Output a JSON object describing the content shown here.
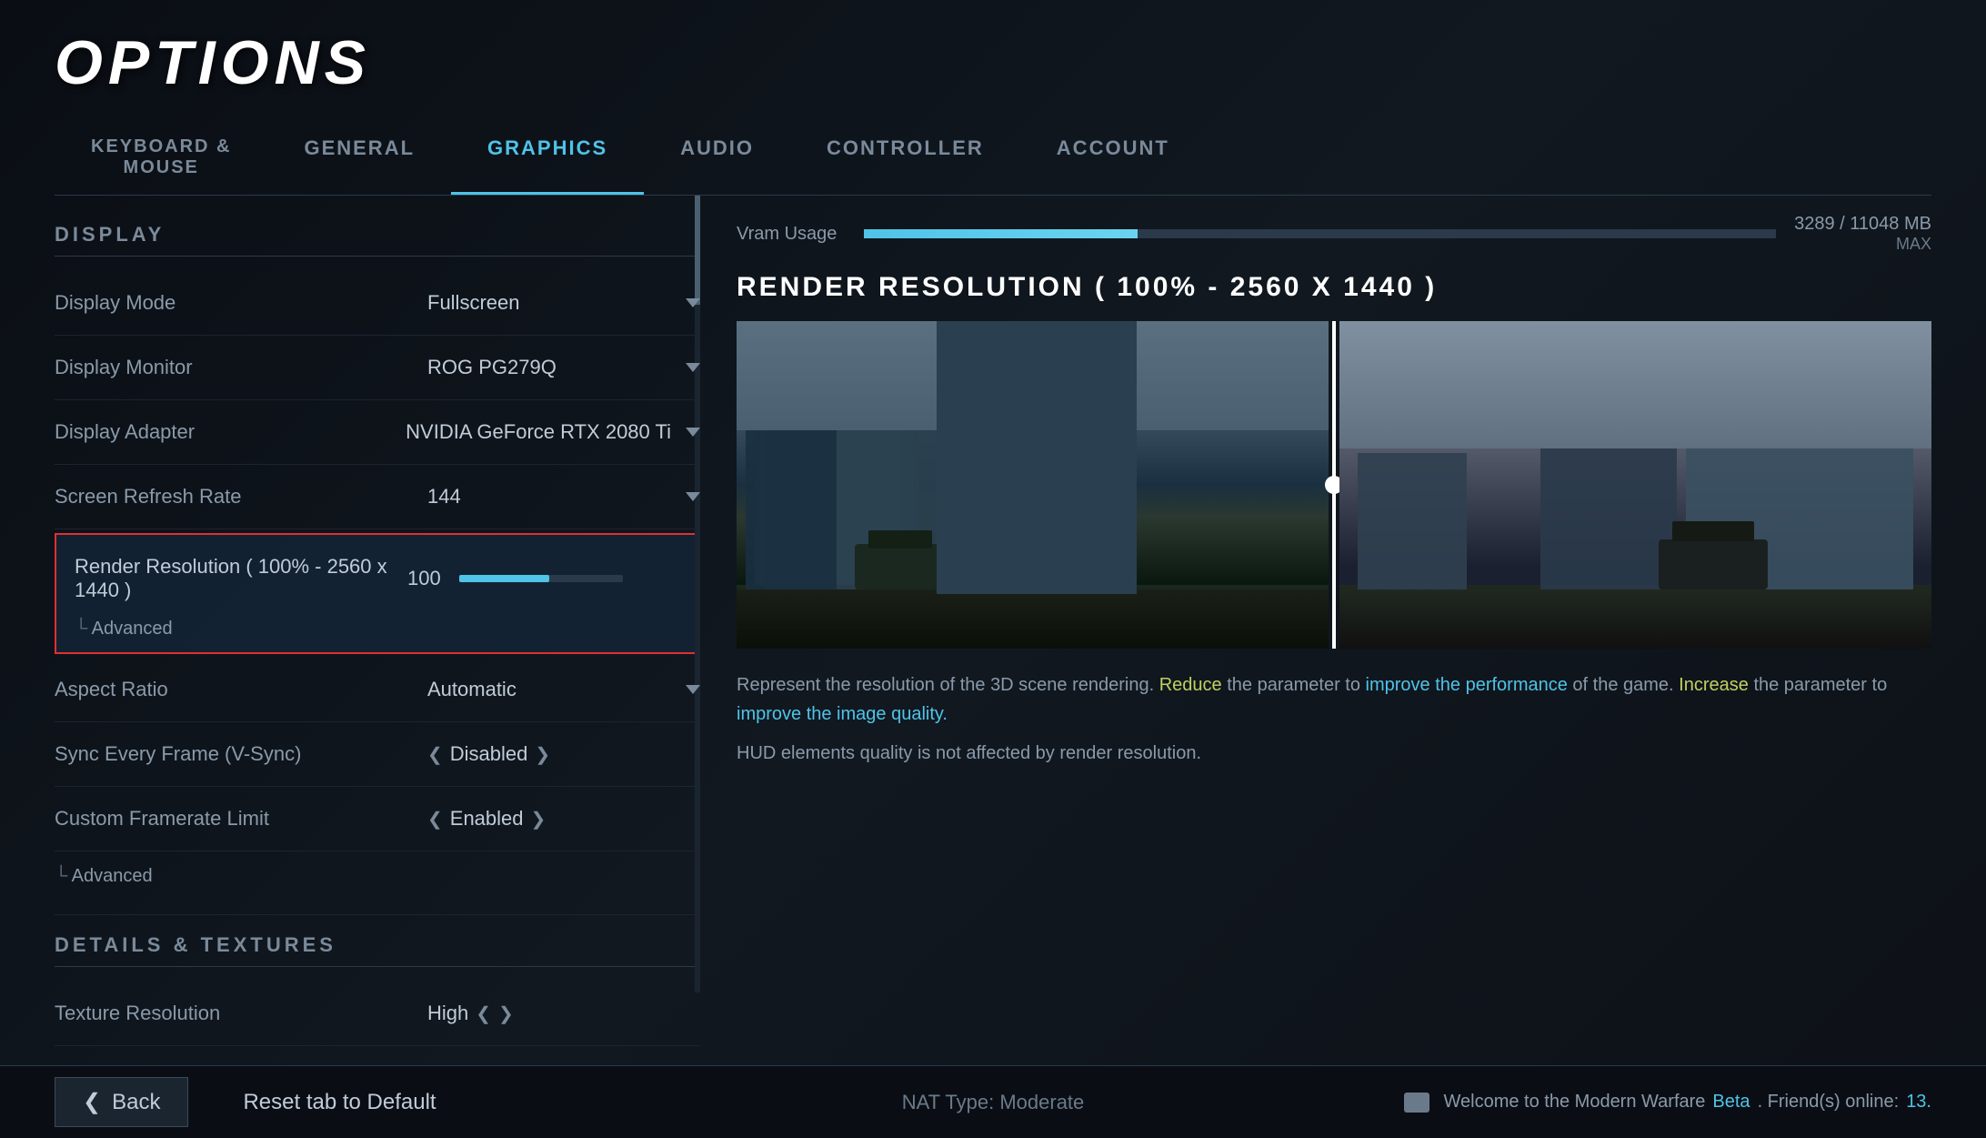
{
  "page": {
    "title": "OPTIONS"
  },
  "nav": {
    "tabs": [
      {
        "id": "keyboard-mouse",
        "label": "KEYBOARD &\nMOUSE",
        "active": false
      },
      {
        "id": "general",
        "label": "GENERAL",
        "active": false
      },
      {
        "id": "graphics",
        "label": "GRAPHICS",
        "active": true
      },
      {
        "id": "audio",
        "label": "AUDIO",
        "active": false
      },
      {
        "id": "controller",
        "label": "CONTROLLER",
        "active": false
      },
      {
        "id": "account",
        "label": "ACCOUNT",
        "active": false
      }
    ]
  },
  "left": {
    "sections": {
      "display": {
        "label": "DISPLAY",
        "settings": [
          {
            "id": "display-mode",
            "label": "Display Mode",
            "value": "Fullscreen",
            "type": "dropdown"
          },
          {
            "id": "display-monitor",
            "label": "Display Monitor",
            "value": "ROG PG279Q",
            "type": "dropdown"
          },
          {
            "id": "display-adapter",
            "label": "Display Adapter",
            "value": "NVIDIA GeForce RTX 2080 Ti",
            "type": "dropdown"
          },
          {
            "id": "screen-refresh-rate",
            "label": "Screen Refresh Rate",
            "value": "144",
            "type": "dropdown"
          }
        ]
      },
      "render": {
        "label": "Render Resolution ( 100% - 2560 x 1440 )",
        "value": "100",
        "sliderPercent": 55,
        "highlighted": true
      },
      "afterRender": {
        "settings": [
          {
            "id": "aspect-ratio",
            "label": "Aspect Ratio",
            "value": "Automatic",
            "type": "dropdown"
          },
          {
            "id": "vsync",
            "label": "Sync Every Frame (V-Sync)",
            "value": "Disabled",
            "type": "arrows"
          },
          {
            "id": "framerate-limit",
            "label": "Custom Framerate Limit",
            "value": "Enabled",
            "type": "arrows"
          }
        ]
      },
      "detailsTextures": {
        "label": "DETAILS & TEXTURES",
        "settings": [
          {
            "id": "texture-resolution",
            "label": "Texture Resolution",
            "value": "High",
            "type": "arrows"
          }
        ]
      }
    }
  },
  "right": {
    "vram": {
      "label": "Vram Usage",
      "current": "3289",
      "total": "11048",
      "unit": "MB",
      "maxLabel": "MAX",
      "fillPercent": 30
    },
    "preview": {
      "title": "RENDER RESOLUTION ( 100% - 2560 X 1440 )",
      "description_part1": "Represent the resolution of the 3D scene rendering. ",
      "reduce_text": "Reduce",
      "description_part2": " the parameter to ",
      "improve_perf": "improve the performance",
      "description_part3": " of the game. ",
      "increase_text": "Increase",
      "description_part4": " the parameter to ",
      "improve_quality": "improve the image quality.",
      "hud_note": "HUD elements quality is not affected by render resolution."
    }
  },
  "bottom": {
    "nat_type": "NAT Type: Moderate",
    "back_label": "Back",
    "reset_label": "Reset tab to Default",
    "welcome_part1": "Welcome to the Modern Warfare ",
    "beta_text": "Beta",
    "welcome_part2": ". Friend(s) online: ",
    "friends_count": "13."
  },
  "advanced_label": "Advanced"
}
